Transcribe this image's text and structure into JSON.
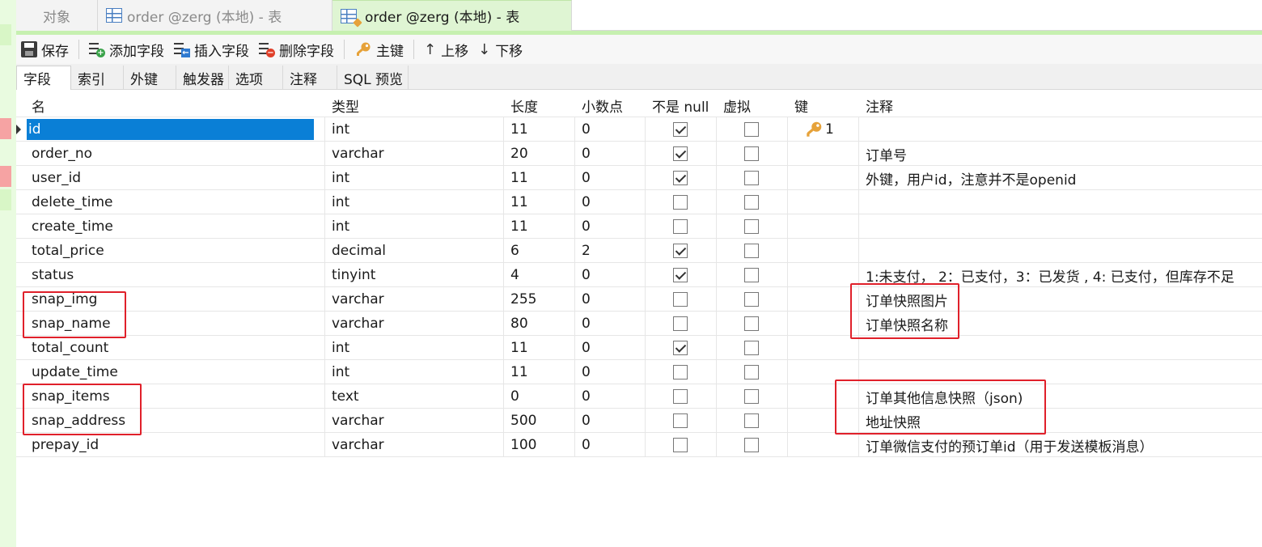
{
  "tabs": [
    {
      "label": "对象"
    },
    {
      "label": "order @zerg (本地) - 表"
    },
    {
      "label": "order @zerg (本地) - 表"
    }
  ],
  "toolbar": {
    "save": "保存",
    "add_field": "添加字段",
    "insert_field": "插入字段",
    "delete_field": "删除字段",
    "primary_key": "主键",
    "move_up": "上移",
    "move_down": "下移"
  },
  "subtabs": [
    "字段",
    "索引",
    "外键",
    "触发器",
    "选项",
    "注释",
    "SQL 预览"
  ],
  "columns": {
    "name": "名",
    "type": "类型",
    "length": "长度",
    "decimals": "小数点",
    "not_null": "不是 null",
    "virtual": "虚拟",
    "key": "键",
    "comment": "注释"
  },
  "rows": [
    {
      "name": "id",
      "type": "int",
      "length": "11",
      "decimals": "0",
      "not_null": true,
      "virtual": false,
      "key": "1",
      "comment": ""
    },
    {
      "name": "order_no",
      "type": "varchar",
      "length": "20",
      "decimals": "0",
      "not_null": true,
      "virtual": false,
      "key": "",
      "comment": "订单号"
    },
    {
      "name": "user_id",
      "type": "int",
      "length": "11",
      "decimals": "0",
      "not_null": true,
      "virtual": false,
      "key": "",
      "comment": "外键，用户id，注意并不是openid"
    },
    {
      "name": "delete_time",
      "type": "int",
      "length": "11",
      "decimals": "0",
      "not_null": false,
      "virtual": false,
      "key": "",
      "comment": ""
    },
    {
      "name": "create_time",
      "type": "int",
      "length": "11",
      "decimals": "0",
      "not_null": false,
      "virtual": false,
      "key": "",
      "comment": ""
    },
    {
      "name": "total_price",
      "type": "decimal",
      "length": "6",
      "decimals": "2",
      "not_null": true,
      "virtual": false,
      "key": "",
      "comment": ""
    },
    {
      "name": "status",
      "type": "tinyint",
      "length": "4",
      "decimals": "0",
      "not_null": true,
      "virtual": false,
      "key": "",
      "comment": "1:未支付， 2：已支付，3：已发货 , 4: 已支付，但库存不足"
    },
    {
      "name": "snap_img",
      "type": "varchar",
      "length": "255",
      "decimals": "0",
      "not_null": false,
      "virtual": false,
      "key": "",
      "comment": "订单快照图片"
    },
    {
      "name": "snap_name",
      "type": "varchar",
      "length": "80",
      "decimals": "0",
      "not_null": false,
      "virtual": false,
      "key": "",
      "comment": "订单快照名称"
    },
    {
      "name": "total_count",
      "type": "int",
      "length": "11",
      "decimals": "0",
      "not_null": true,
      "virtual": false,
      "key": "",
      "comment": ""
    },
    {
      "name": "update_time",
      "type": "int",
      "length": "11",
      "decimals": "0",
      "not_null": false,
      "virtual": false,
      "key": "",
      "comment": ""
    },
    {
      "name": "snap_items",
      "type": "text",
      "length": "0",
      "decimals": "0",
      "not_null": false,
      "virtual": false,
      "key": "",
      "comment": "订单其他信息快照（json)"
    },
    {
      "name": "snap_address",
      "type": "varchar",
      "length": "500",
      "decimals": "0",
      "not_null": false,
      "virtual": false,
      "key": "",
      "comment": "地址快照"
    },
    {
      "name": "prepay_id",
      "type": "varchar",
      "length": "100",
      "decimals": "0",
      "not_null": false,
      "virtual": false,
      "key": "",
      "comment": "订单微信支付的预订单id（用于发送模板消息）"
    }
  ],
  "colors": {
    "accent_green": "#c6f0b0",
    "selection_blue": "#0a7fd6",
    "annotation_red": "#e0202a",
    "key_gold": "#e6a23a"
  }
}
